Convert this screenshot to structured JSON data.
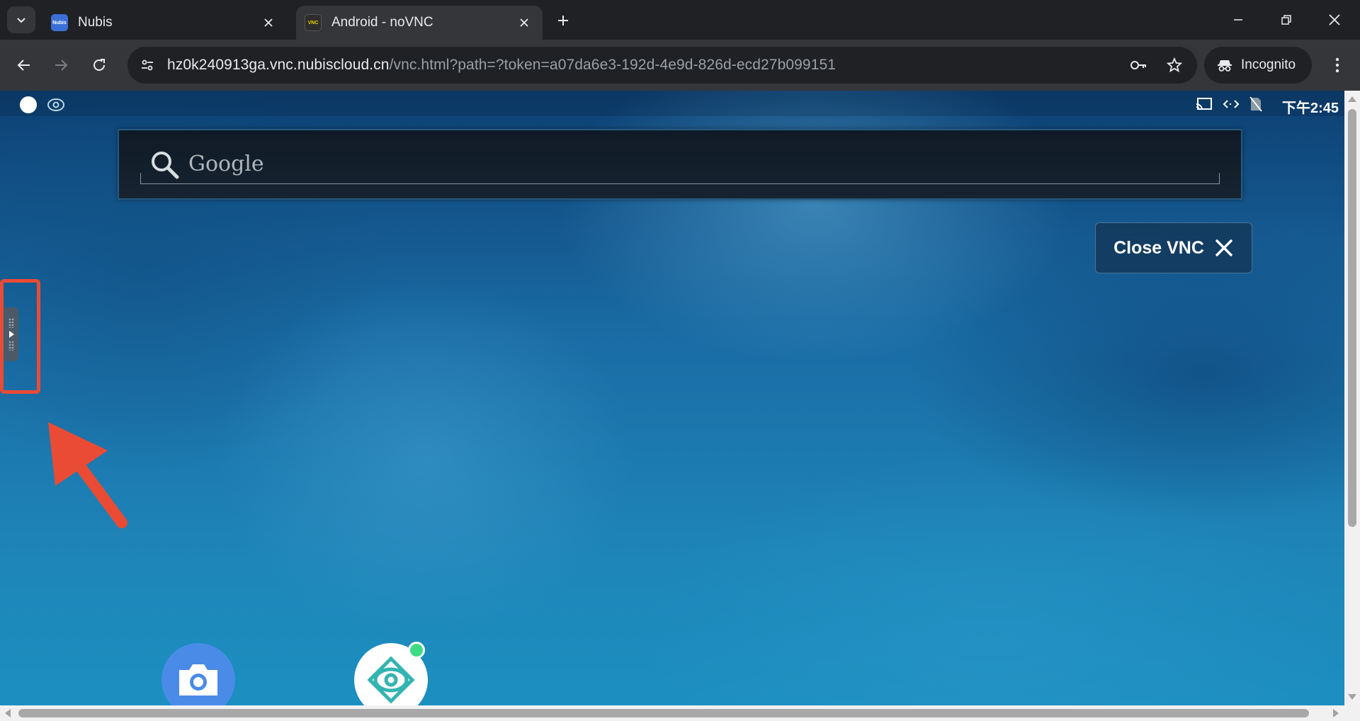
{
  "browser": {
    "tabs": [
      {
        "title": "Nubis",
        "favicon": "nubis-favicon",
        "active": false
      },
      {
        "title": "Android - noVNC",
        "favicon": "vnc-favicon",
        "active": true
      }
    ],
    "favicon_text": {
      "nubis": "Nubis",
      "vnc": "VNC"
    },
    "address": {
      "host": "hz0k240913ga.vnc.nubiscloud.cn",
      "path": "/vnc.html?path=?token=a07da6e3-192d-4e9d-826d-ecd27b099151"
    },
    "profile_label": "Incognito"
  },
  "android": {
    "status_time": "下午2:45",
    "search_label": "Google",
    "close_vnc_label": "Close VNC",
    "apps": [
      {
        "name": "camera",
        "icon": "camera-icon"
      },
      {
        "name": "nubis-app",
        "icon": "eye-swirl-icon"
      }
    ]
  },
  "colors": {
    "annotation": "#ea4b35",
    "wallpaper": "#1b6ea0",
    "active_tab": "#35363a",
    "browser_frame": "#202124"
  }
}
